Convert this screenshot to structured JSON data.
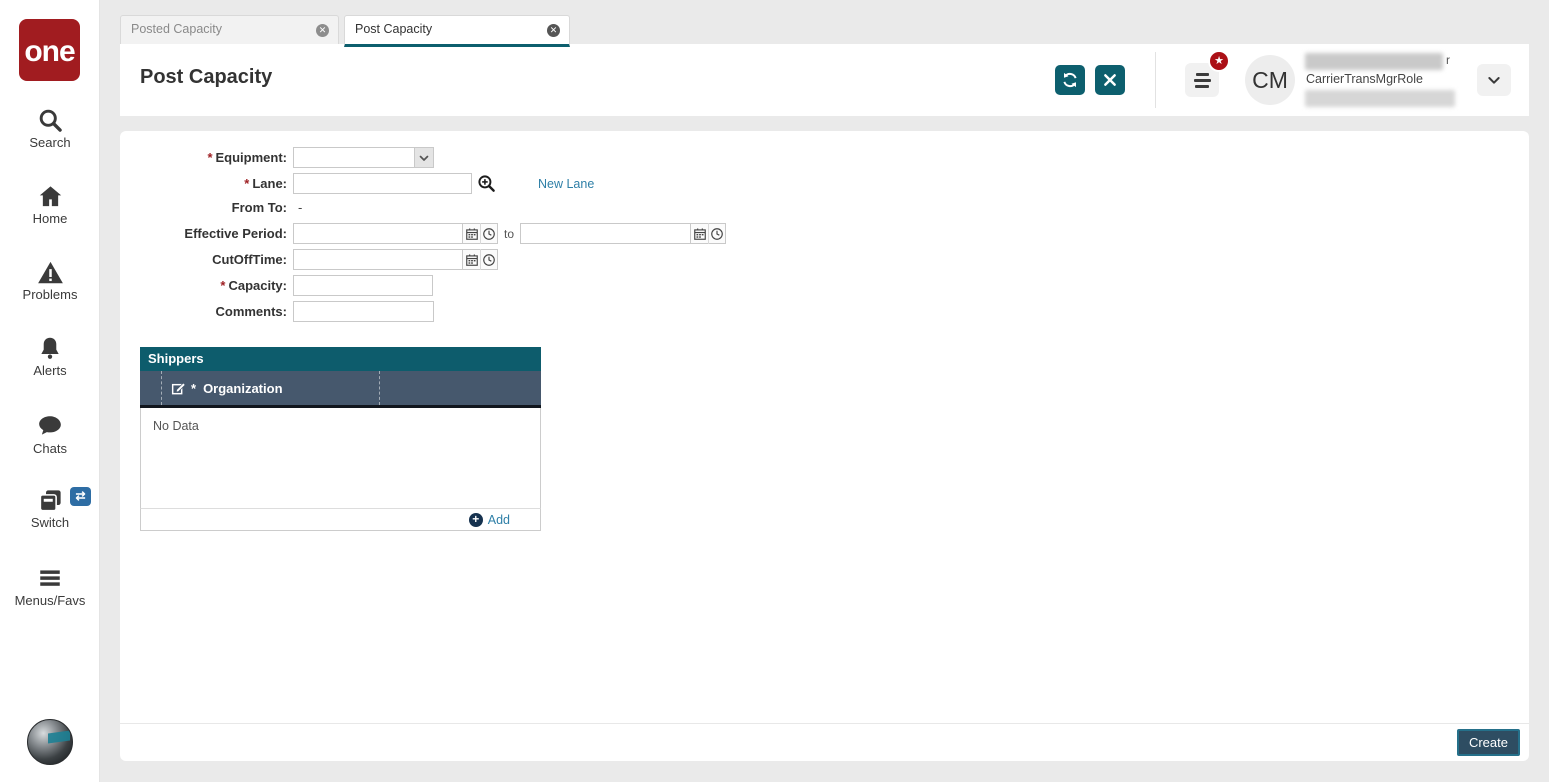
{
  "app": {
    "logo_text": "one",
    "colors": {
      "brand_red": "#a11c20",
      "accent_teal": "#0d5f6e",
      "panel_slate": "#46586d",
      "link_blue": "#2e7fa7",
      "create_button_bg": "#2e4d62",
      "badge_red": "#ab1016",
      "switch_badge_blue": "#2e6da4"
    }
  },
  "sidebar": {
    "items": [
      {
        "label": "Search",
        "icon": "search-icon"
      },
      {
        "label": "Home",
        "icon": "home-icon"
      },
      {
        "label": "Problems",
        "icon": "warning-triangle-icon"
      },
      {
        "label": "Alerts",
        "icon": "bell-icon"
      },
      {
        "label": "Chats",
        "icon": "chat-bubble-icon"
      },
      {
        "label": "Switch",
        "icon": "switch-windows-icon",
        "badge_glyph": "⇄"
      },
      {
        "label": "Menus/Favs",
        "icon": "hamburger-icon"
      }
    ]
  },
  "tabs": {
    "items": [
      {
        "label": "Posted Capacity",
        "active": false,
        "close_glyph": "✕"
      },
      {
        "label": "Post Capacity",
        "active": true,
        "close_glyph": "✕"
      }
    ]
  },
  "header": {
    "title": "Post Capacity",
    "user": {
      "initials": "CM",
      "role": "CarrierTransMgrRole",
      "name_visible_char": "r"
    },
    "notification_badge_glyph": "★"
  },
  "form": {
    "required_marker": "*",
    "equipment_label": "Equipment:",
    "lane_label": "Lane:",
    "new_lane_link": "New Lane",
    "from_to_label": "From To:",
    "from_to_value": "-",
    "effective_period_label": "Effective Period:",
    "to_label": "to",
    "cutofftime_label": "CutOffTime:",
    "capacity_label": "Capacity:",
    "comments_label": "Comments:"
  },
  "shippers": {
    "panel_title": "Shippers",
    "column_header": "Organization",
    "empty_text": "No Data",
    "add_label": "Add",
    "add_plus_glyph": "+"
  },
  "footer": {
    "create_label": "Create"
  }
}
